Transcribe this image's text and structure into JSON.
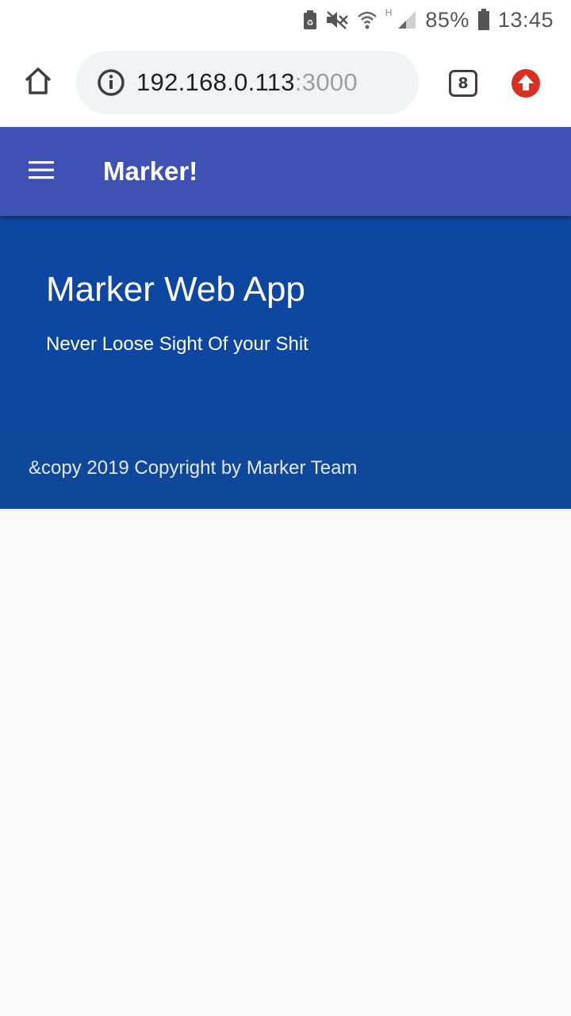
{
  "status_bar": {
    "network_type": "H",
    "battery": "85%",
    "time": "13:45"
  },
  "browser": {
    "url_host": "192.168.0.113",
    "url_port": ":3000",
    "tab_count": "8"
  },
  "app_bar": {
    "title": "Marker!"
  },
  "hero": {
    "title": "Marker Web App",
    "subtitle": "Never Loose Sight Of your Shit"
  },
  "footer": {
    "text": "&copy 2019 Copyright by Marker Team"
  },
  "colors": {
    "app_bar": "#3f51b5",
    "hero": "#0d47a1",
    "footer": "#0f479a",
    "page_background": "#fafafa",
    "update_badge": "#d93025"
  }
}
